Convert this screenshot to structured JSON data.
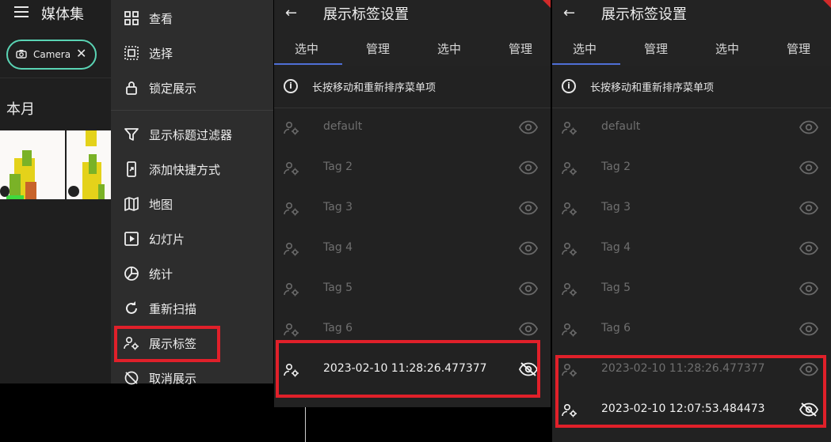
{
  "app": {
    "title": "媒体集"
  },
  "filter_chip": {
    "label": "Camera",
    "remove_glyph": "✕",
    "icon": "camera-icon"
  },
  "section": {
    "month": "本月"
  },
  "menu": {
    "items": [
      {
        "label": "查看",
        "icon": "grid-icon"
      },
      {
        "label": "选择",
        "icon": "select-icon"
      },
      {
        "label": "锁定展示",
        "icon": "lock-icon"
      },
      {
        "label": "显示标题过滤器",
        "icon": "filter-icon"
      },
      {
        "label": "添加快捷方式",
        "icon": "shortcut-icon"
      },
      {
        "label": "地图",
        "icon": "map-icon"
      },
      {
        "label": "幻灯片",
        "icon": "slideshow-icon"
      },
      {
        "label": "统计",
        "icon": "stats-icon"
      },
      {
        "label": "重新扫描",
        "icon": "refresh-icon"
      },
      {
        "label": "展示标签",
        "icon": "tag-person-icon"
      },
      {
        "label": "取消展示",
        "icon": "hide-icon"
      }
    ]
  },
  "settings_left": {
    "title": "展示标签设置",
    "tabs": [
      "选中",
      "管理",
      "选中",
      "管理"
    ],
    "hint": "长按移动和重新排序菜单项",
    "rows": [
      {
        "label": "default",
        "state": "dim"
      },
      {
        "label": "Tag 2",
        "state": "dim"
      },
      {
        "label": "Tag 3",
        "state": "dim"
      },
      {
        "label": "Tag 4",
        "state": "dim"
      },
      {
        "label": "Tag 5",
        "state": "dim"
      },
      {
        "label": "Tag 6",
        "state": "dim"
      },
      {
        "label": "2023-02-10 11:28:26.477377",
        "state": "hidden"
      }
    ]
  },
  "settings_right": {
    "title": "展示标签设置",
    "tabs": [
      "选中",
      "管理",
      "选中",
      "管理"
    ],
    "hint": "长按移动和重新排序菜单项",
    "rows": [
      {
        "label": "default",
        "state": "dim"
      },
      {
        "label": "Tag 2",
        "state": "dim"
      },
      {
        "label": "Tag 3",
        "state": "dim"
      },
      {
        "label": "Tag 4",
        "state": "dim"
      },
      {
        "label": "Tag 5",
        "state": "dim"
      },
      {
        "label": "Tag 6",
        "state": "dim"
      },
      {
        "label": "2023-02-10 11:28:26.477377",
        "state": "dim"
      },
      {
        "label": "2023-02-10 12:07:53.484473",
        "state": "hidden"
      }
    ]
  },
  "colors": {
    "accent_tab": "#4f6fd6",
    "highlight": "#e0202a",
    "chip_border": "#5ad4b4"
  }
}
